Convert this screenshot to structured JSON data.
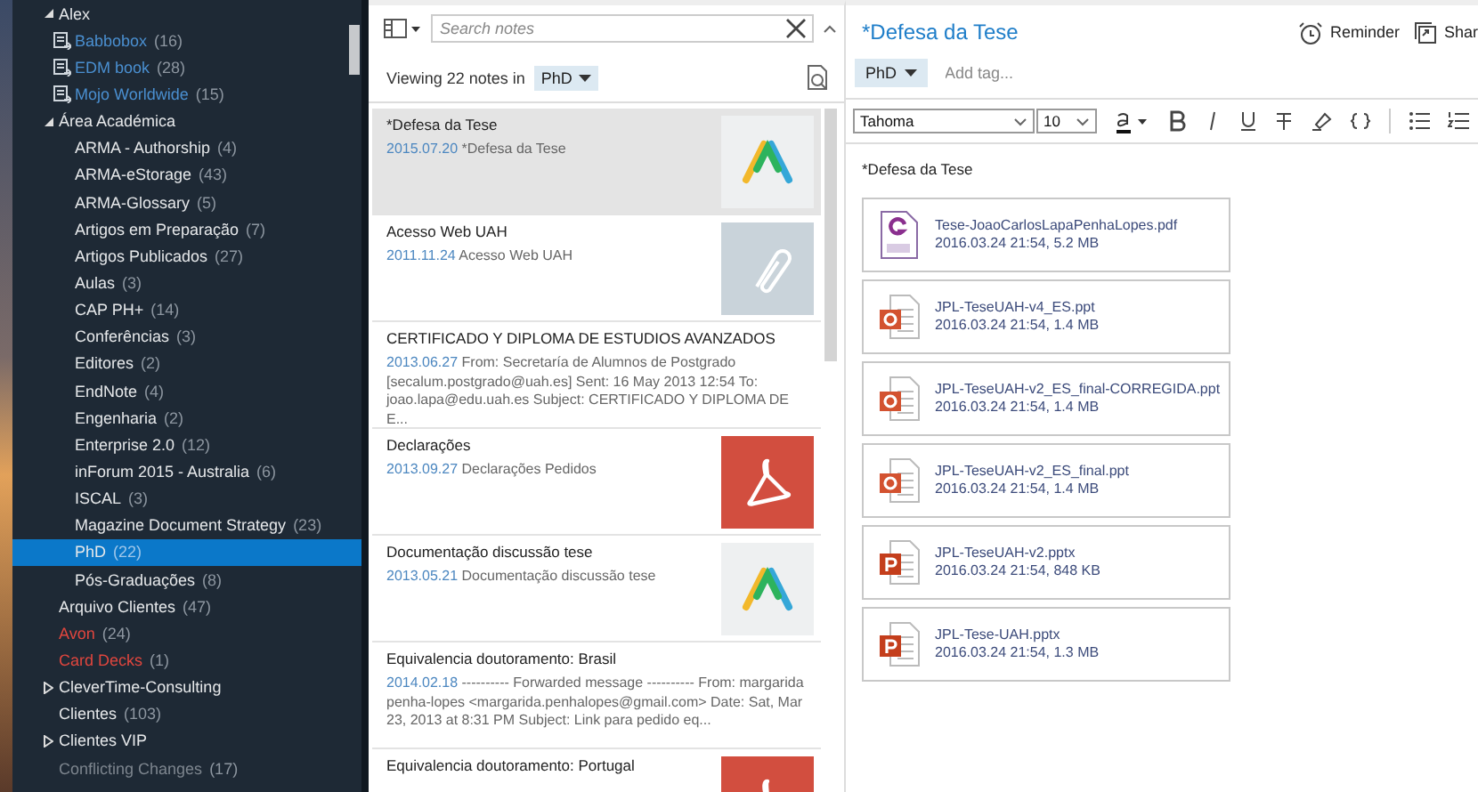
{
  "sidebar": {
    "items": [
      {
        "label": "Alex",
        "kind": "plain",
        "expanded": true,
        "selected": false,
        "children": [
          {
            "label": "Babbobox",
            "count": "(16)",
            "kind": "linked",
            "selected": false
          },
          {
            "label": "EDM book",
            "count": "(28)",
            "kind": "linked",
            "selected": false
          },
          {
            "label": "Mojo Worldwide",
            "count": "(15)",
            "kind": "linked",
            "selected": false
          }
        ]
      },
      {
        "label": "Área Académica",
        "kind": "plain",
        "expanded": true,
        "selected": false,
        "children": [
          {
            "label": "ARMA - Authorship",
            "count": "(4)",
            "kind": "plain",
            "selected": false
          },
          {
            "label": "ARMA-eStorage",
            "count": "(43)",
            "kind": "plain",
            "selected": false
          },
          {
            "label": "ARMA-Glossary",
            "count": "(5)",
            "kind": "plain",
            "selected": false
          },
          {
            "label": "Artigos em Preparação",
            "count": "(7)",
            "kind": "plain",
            "selected": false
          },
          {
            "label": "Artigos Publicados",
            "count": "(27)",
            "kind": "plain",
            "selected": false
          },
          {
            "label": "Aulas",
            "count": "(3)",
            "kind": "plain",
            "selected": false
          },
          {
            "label": "CAP  PH+",
            "count": "(14)",
            "kind": "plain",
            "selected": false
          },
          {
            "label": "Conferências",
            "count": "(3)",
            "kind": "plain",
            "selected": false
          },
          {
            "label": "Editores",
            "count": "(2)",
            "kind": "plain",
            "selected": false
          },
          {
            "label": "EndNote",
            "count": "(4)",
            "kind": "plain",
            "selected": false
          },
          {
            "label": "Engenharia",
            "count": "(2)",
            "kind": "plain",
            "selected": false
          },
          {
            "label": "Enterprise 2.0",
            "count": "(12)",
            "kind": "plain",
            "selected": false
          },
          {
            "label": "inForum 2015 - Australia",
            "count": "(6)",
            "kind": "plain",
            "selected": false
          },
          {
            "label": "ISCAL",
            "count": "(3)",
            "kind": "plain",
            "selected": false
          },
          {
            "label": "Magazine Document Strategy",
            "count": "(23)",
            "kind": "plain",
            "selected": false
          },
          {
            "label": "PhD",
            "count": "(22)",
            "kind": "plain",
            "selected": true
          },
          {
            "label": "Pós-Graduações",
            "count": "(8)",
            "kind": "plain",
            "selected": false
          }
        ]
      },
      {
        "label": "Arquivo Clientes",
        "count": "(47)",
        "kind": "plain",
        "selected": false
      },
      {
        "label": "Avon",
        "count": "(24)",
        "kind": "alert",
        "selected": false
      },
      {
        "label": "Card Decks",
        "count": "(1)",
        "kind": "alert",
        "selected": false
      },
      {
        "label": "CleverTime-Consulting",
        "kind": "plain",
        "expanded": false,
        "selected": false
      },
      {
        "label": "Clientes",
        "count": "(103)",
        "kind": "plain",
        "selected": false
      },
      {
        "label": "Clientes VIP",
        "kind": "plain",
        "expanded": false,
        "selected": false
      },
      {
        "label": "Conflicting Changes",
        "count": "(17)",
        "kind": "conflict",
        "selected": false
      }
    ]
  },
  "note_list": {
    "search": {
      "placeholder": "Search notes"
    },
    "viewing": "Viewing 22 notes in",
    "notebook": "PhD",
    "notes": [
      {
        "title": "*Defesa da Tese",
        "date": "2015.07.20",
        "snippet": "*Defesa da Tese",
        "kind": "app",
        "selected": true
      },
      {
        "title": "Acesso Web UAH",
        "date": "2011.11.24",
        "snippet": "Acesso Web UAH",
        "kind": "attachment",
        "selected": false
      },
      {
        "title": "CERTIFICADO Y DIPLOMA DE ESTUDIOS AVANZADOS",
        "date": "2013.06.27",
        "snippet": "From: Secretaría de Alumnos de Postgrado [secalum.postgrado@uah.es] Sent: 16 May 2013 12:54 To: joao.lapa@edu.uah.es Subject: CERTIFICADO Y DIPLOMA DE E...",
        "kind": "text",
        "selected": false
      },
      {
        "title": "Declarações",
        "date": "2013.09.27",
        "snippet": "Declarações Pedidos",
        "kind": "pdf",
        "selected": false
      },
      {
        "title": "Documentação discussão tese",
        "date": "2013.05.21",
        "snippet": "Documentação discussão tese",
        "kind": "app",
        "selected": false
      },
      {
        "title": "Equivalencia doutoramento: Brasil",
        "date": "2014.02.18",
        "snippet": "---------- Forwarded message ---------- From: margarida penha-lopes <margarida.penhalopes@gmail.com> Date: Sat, Mar 23, 2013 at 8:31 PM Subject: Link para pedido eq...",
        "kind": "text",
        "selected": false
      },
      {
        "title": "Equivalencia doutoramento: Portugal",
        "kind": "pdf",
        "selected": false
      }
    ]
  },
  "editor": {
    "title": "*Defesa da Tese",
    "actions": [
      "Reminder",
      "Shar"
    ],
    "tag": "PhD",
    "tag_input": {
      "placeholder": "Add tag..."
    },
    "font": "Tahoma",
    "size": "10",
    "heading": "*Defesa da Tese",
    "attachments": [
      {
        "name": "Tese-JoaoCarlosLapaPenhaLopes.pdf",
        "meta": "2016.03.24 21:54, 5.2 MB",
        "kind": "pdf"
      },
      {
        "name": "JPL-TeseUAH-v4_ES.ppt",
        "meta": "2016.03.24 21:54, 1.4 MB",
        "kind": "ppt"
      },
      {
        "name": "JPL-TeseUAH-v2_ES_final-CORREGIDA.ppt",
        "meta": "2016.03.24 21:54, 1.4 MB",
        "kind": "ppt"
      },
      {
        "name": "JPL-TeseUAH-v2_ES_final.ppt",
        "meta": "2016.03.24 21:54, 1.4 MB",
        "kind": "ppt"
      },
      {
        "name": "JPL-TeseUAH-v2.pptx",
        "meta": "2016.03.24 21:54, 848 KB",
        "kind": "pptx"
      },
      {
        "name": "JPL-Tese-UAH.pptx",
        "meta": "2016.03.24 21:54, 1.3 MB",
        "kind": "pptx"
      }
    ]
  }
}
